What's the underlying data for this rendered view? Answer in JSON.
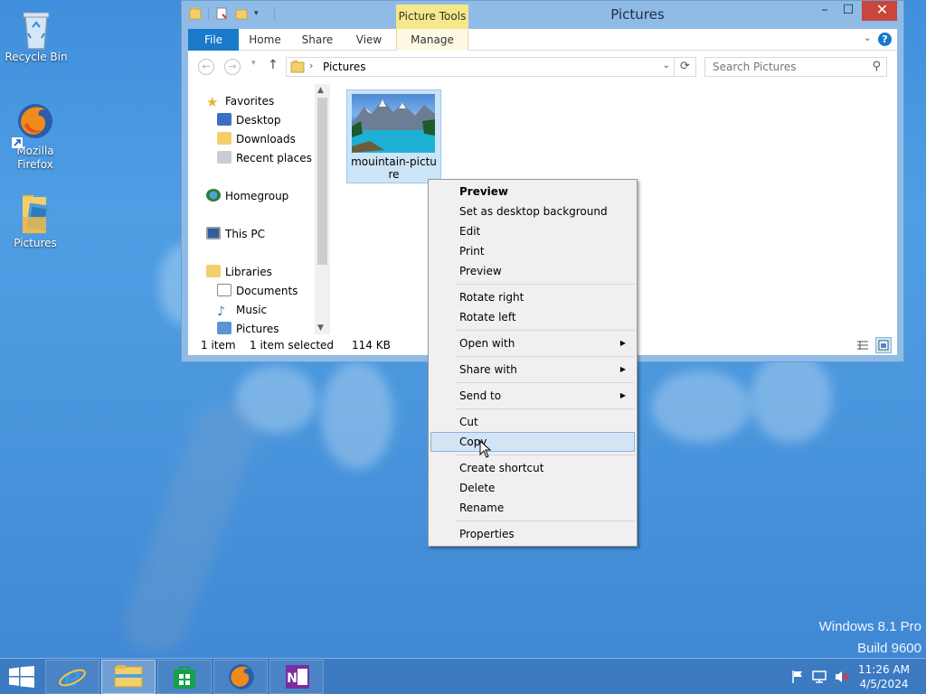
{
  "desktop": {
    "icons": [
      {
        "label": "Recycle Bin"
      },
      {
        "label": "Mozilla Firefox"
      },
      {
        "label": "Pictures"
      }
    ],
    "watermark_line1": "Windows 8.1 Pro",
    "watermark_line2": "Build 9600"
  },
  "window": {
    "title": "Pictures",
    "contextual_tab_group": "Picture Tools",
    "controls": {
      "minimize": "–",
      "maximize": "☐",
      "close": "✕"
    },
    "ribbon_tabs": [
      "File",
      "Home",
      "Share",
      "View",
      "Manage"
    ],
    "help_label": "?",
    "address": {
      "breadcrumb_sep": "›",
      "location": "Pictures"
    },
    "search": {
      "placeholder": "Search Pictures"
    },
    "nav_pane": {
      "favorites": "Favorites",
      "favorites_items": [
        "Desktop",
        "Downloads",
        "Recent places"
      ],
      "homegroup": "Homegroup",
      "this_pc": "This PC",
      "libraries": "Libraries",
      "libraries_items": [
        "Documents",
        "Music",
        "Pictures"
      ]
    },
    "files": [
      {
        "name": "mouintain-picture",
        "selected": true
      }
    ],
    "status": {
      "item_count": "1 item",
      "selection": "1 item selected",
      "size": "114 KB"
    }
  },
  "context_menu": {
    "items": [
      {
        "label": "Preview",
        "bold": true
      },
      {
        "label": "Set as desktop background"
      },
      {
        "label": "Edit"
      },
      {
        "label": "Print"
      },
      {
        "label": "Preview"
      },
      {
        "label": "Rotate right"
      },
      {
        "label": "Rotate left"
      },
      {
        "label": "Open with",
        "submenu": true
      },
      {
        "label": "Share with",
        "submenu": true
      },
      {
        "label": "Send to",
        "submenu": true
      },
      {
        "label": "Cut"
      },
      {
        "label": "Copy",
        "highlighted": true
      },
      {
        "label": "Create shortcut"
      },
      {
        "label": "Delete"
      },
      {
        "label": "Rename"
      },
      {
        "label": "Properties"
      }
    ]
  },
  "taskbar": {
    "clock_time": "11:26 AM",
    "clock_date": "4/5/2024"
  }
}
